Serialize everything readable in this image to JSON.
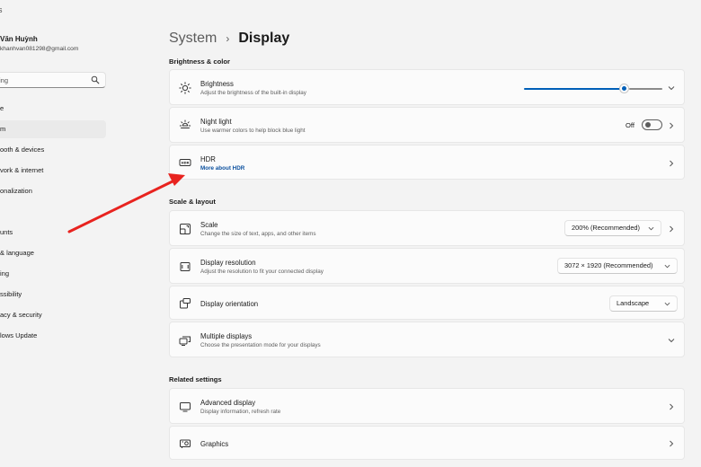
{
  "window": {
    "title_glyph": "s"
  },
  "account": {
    "name": "Văn Huỳnh",
    "email": "khanhvan081298@gmail.com"
  },
  "search": {
    "value": "ing"
  },
  "sidebar": {
    "items": [
      {
        "label": "e"
      },
      {
        "label": "m",
        "active": true
      },
      {
        "label": "ooth & devices"
      },
      {
        "label": "vork & internet"
      },
      {
        "label": "onalization"
      },
      {
        "label": ""
      },
      {
        "label": "unts"
      },
      {
        "label": "& language"
      },
      {
        "label": "ing"
      },
      {
        "label": "ssibility"
      },
      {
        "label": "acy & security"
      },
      {
        "label": "lows Update"
      }
    ]
  },
  "breadcrumb": {
    "parent": "System",
    "separator": "›",
    "current": "Display"
  },
  "sections": {
    "brightness_color": "Brightness & color",
    "scale_layout": "Scale & layout",
    "related": "Related settings"
  },
  "brightness": {
    "title": "Brightness",
    "subtitle": "Adjust the brightness of the built-in display",
    "level": 0.72
  },
  "night_light": {
    "title": "Night light",
    "subtitle": "Use warmer colors to help block blue light",
    "state": "Off"
  },
  "hdr": {
    "title": "HDR",
    "link": "More about HDR"
  },
  "scale": {
    "title": "Scale",
    "subtitle": "Change the size of text, apps, and other items",
    "value": "200% (Recommended)"
  },
  "resolution": {
    "title": "Display resolution",
    "subtitle": "Adjust the resolution to fit your connected display",
    "value": "3072 × 1920 (Recommended)"
  },
  "orientation": {
    "title": "Display orientation",
    "value": "Landscape"
  },
  "multiple_displays": {
    "title": "Multiple displays",
    "subtitle": "Choose the presentation mode for your displays"
  },
  "advanced_display": {
    "title": "Advanced display",
    "subtitle": "Display information, refresh rate"
  },
  "graphics": {
    "title": "Graphics"
  },
  "colors": {
    "accent": "#005fb8",
    "annotation": "#e8231f",
    "link": "#0a4f9e"
  }
}
